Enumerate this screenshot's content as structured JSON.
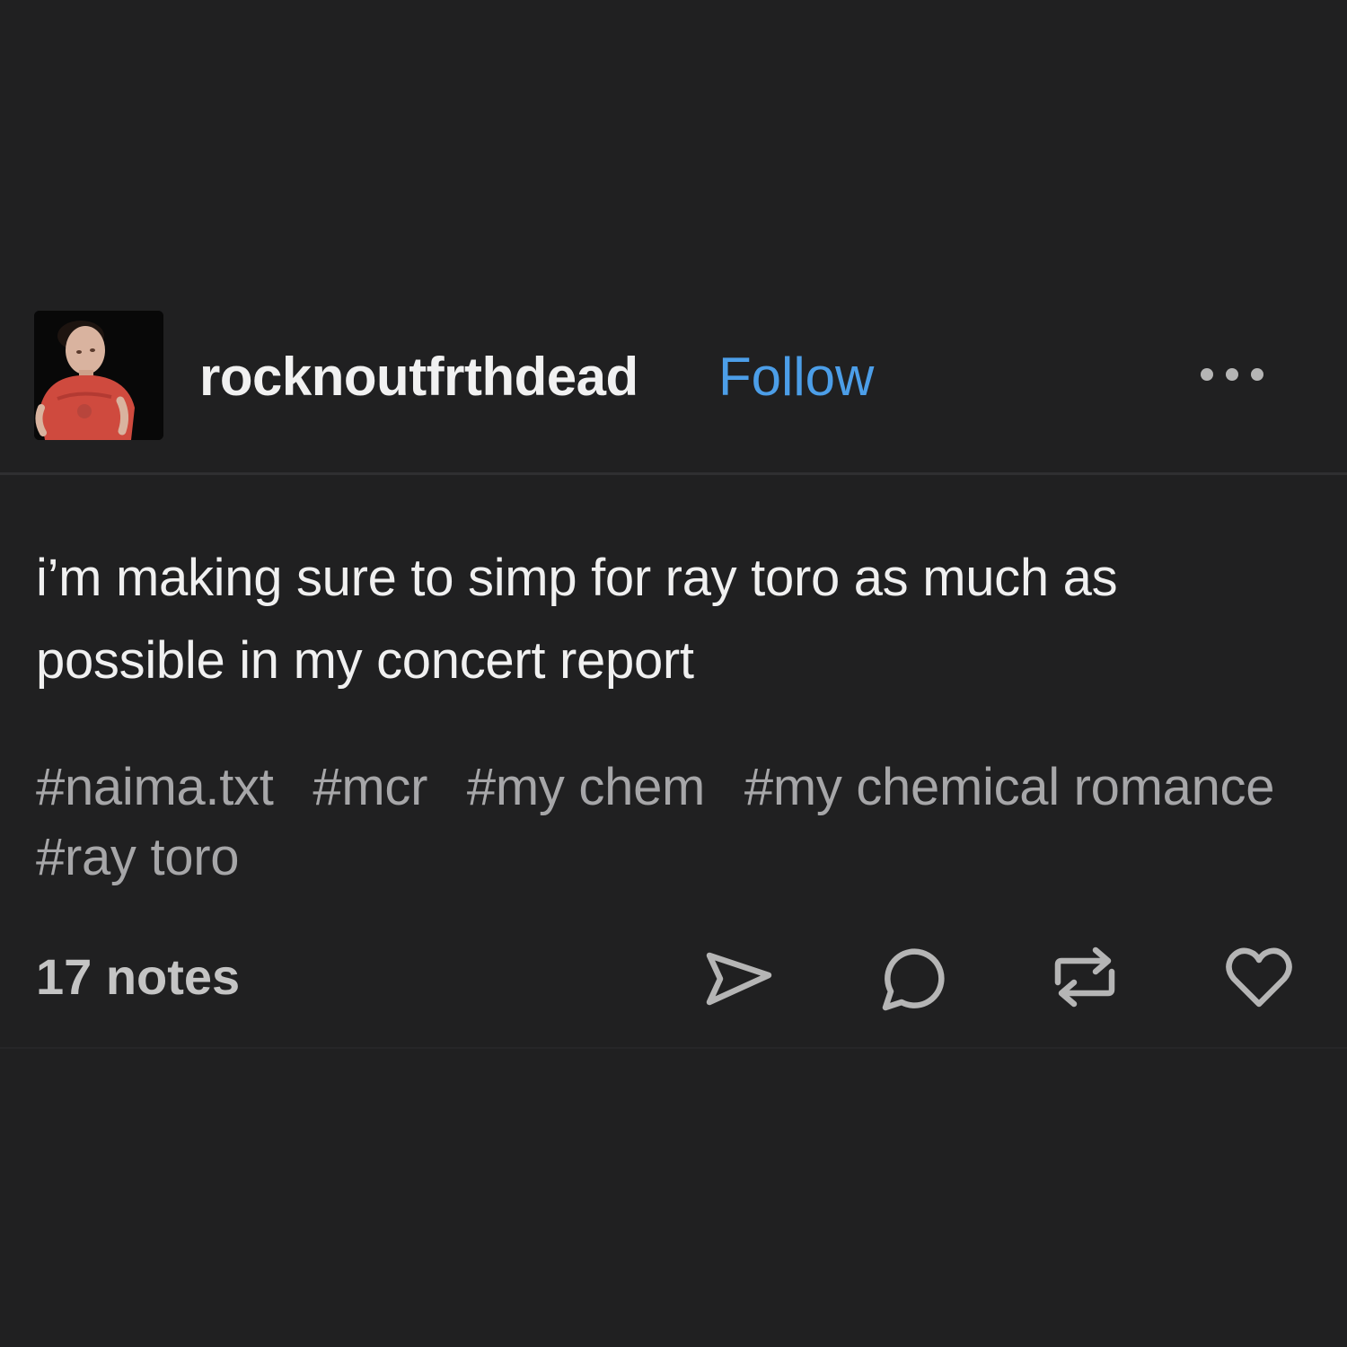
{
  "post": {
    "author": {
      "username": "rocknoutfrthdead",
      "follow_label": "Follow",
      "avatar_icon": "user-avatar-photo"
    },
    "more_icon": "more-options-icon",
    "body": "i’m making sure to simp for ray toro as much as possible in my concert report",
    "tags": [
      "#naima.txt",
      "#mcr",
      "#my chem",
      "#my chemical romance",
      "#ray toro"
    ],
    "notes_label": "17 notes",
    "actions": [
      {
        "name": "share",
        "icon": "send-icon"
      },
      {
        "name": "reply",
        "icon": "comment-icon"
      },
      {
        "name": "reblog",
        "icon": "reblog-icon"
      },
      {
        "name": "like",
        "icon": "heart-icon"
      }
    ]
  },
  "colors": {
    "background": "#202021",
    "text_primary": "#f0f0f0",
    "text_secondary": "#a6a6a8",
    "follow_blue": "#4c9ee8",
    "icon_gray": "#b5b5b5"
  }
}
